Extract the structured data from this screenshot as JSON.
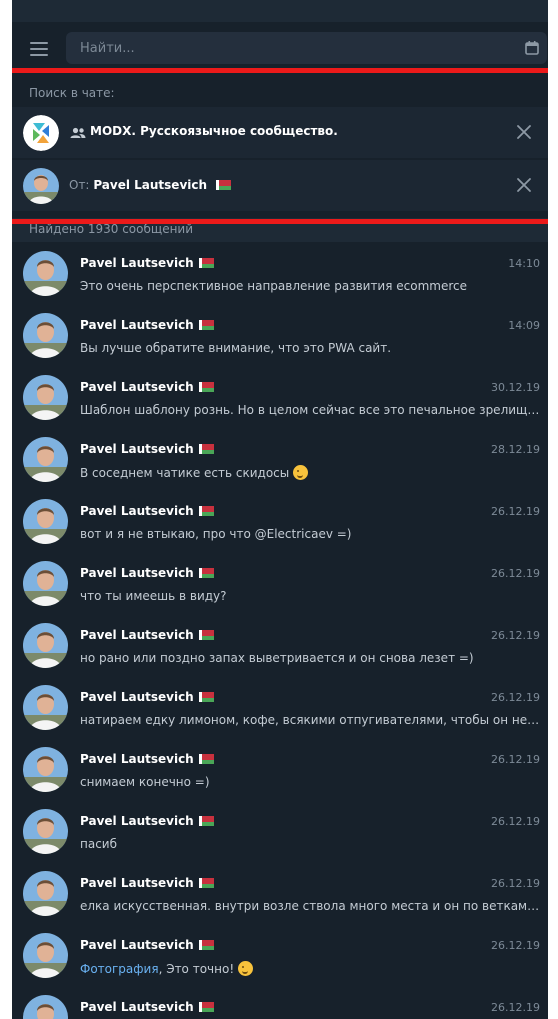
{
  "search": {
    "placeholder": "Найти..."
  },
  "filters": {
    "label": "Поиск в чате:",
    "chat_name": "MODX. Русскоязычное сообщество.",
    "from_prefix": "От:",
    "from_name": "Pavel Lautsevich"
  },
  "results": {
    "header": "Найдено 1930 сообщений",
    "items": [
      {
        "sender": "Pavel Lautsevich",
        "time": "14:10",
        "text": "Это очень перспективное направление развития ecommerce"
      },
      {
        "sender": "Pavel Lautsevich",
        "time": "14:09",
        "text": "Вы лучше обратите внимание, что это PWA сайт."
      },
      {
        "sender": "Pavel Lautsevich",
        "time": "30.12.19",
        "text": "Шаблон шаблону рознь. Но в целом сейчас все это печальное зрелище..."
      },
      {
        "sender": "Pavel Lautsevich",
        "time": "28.12.19",
        "text": "В соседнем чатике есть скидосы"
      },
      {
        "sender": "Pavel Lautsevich",
        "time": "26.12.19",
        "text": "вот и я не втыкаю, про что @Electricaev =)"
      },
      {
        "sender": "Pavel Lautsevich",
        "time": "26.12.19",
        "text": "что ты имеешь в виду?"
      },
      {
        "sender": "Pavel Lautsevich",
        "time": "26.12.19",
        "text": "но рано или поздно запах выветривается и он снова лезет =)"
      },
      {
        "sender": "Pavel Lautsevich",
        "time": "26.12.19",
        "text": "натираем едку лимоном, кофе, всякими отпугивателями, чтобы он не лезет"
      },
      {
        "sender": "Pavel Lautsevich",
        "time": "26.12.19",
        "text": "снимаем конечно =)"
      },
      {
        "sender": "Pavel Lautsevich",
        "time": "26.12.19",
        "text": "пасиб"
      },
      {
        "sender": "Pavel Lautsevich",
        "time": "26.12.19",
        "text": "елка искусственная. внутри возле ствола много места и он по веткам там лазит"
      },
      {
        "sender": "Pavel Lautsevich",
        "time": "26.12.19",
        "link": "Фотография",
        "text": ", Это точно!"
      },
      {
        "sender": "Pavel Lautsevich",
        "time": "26.12.19",
        "text": ""
      }
    ]
  },
  "colors": {
    "background": "#17212b",
    "row_background": "#1c2733",
    "highlight": "#ec1a1a",
    "link": "#6ab2f2"
  }
}
